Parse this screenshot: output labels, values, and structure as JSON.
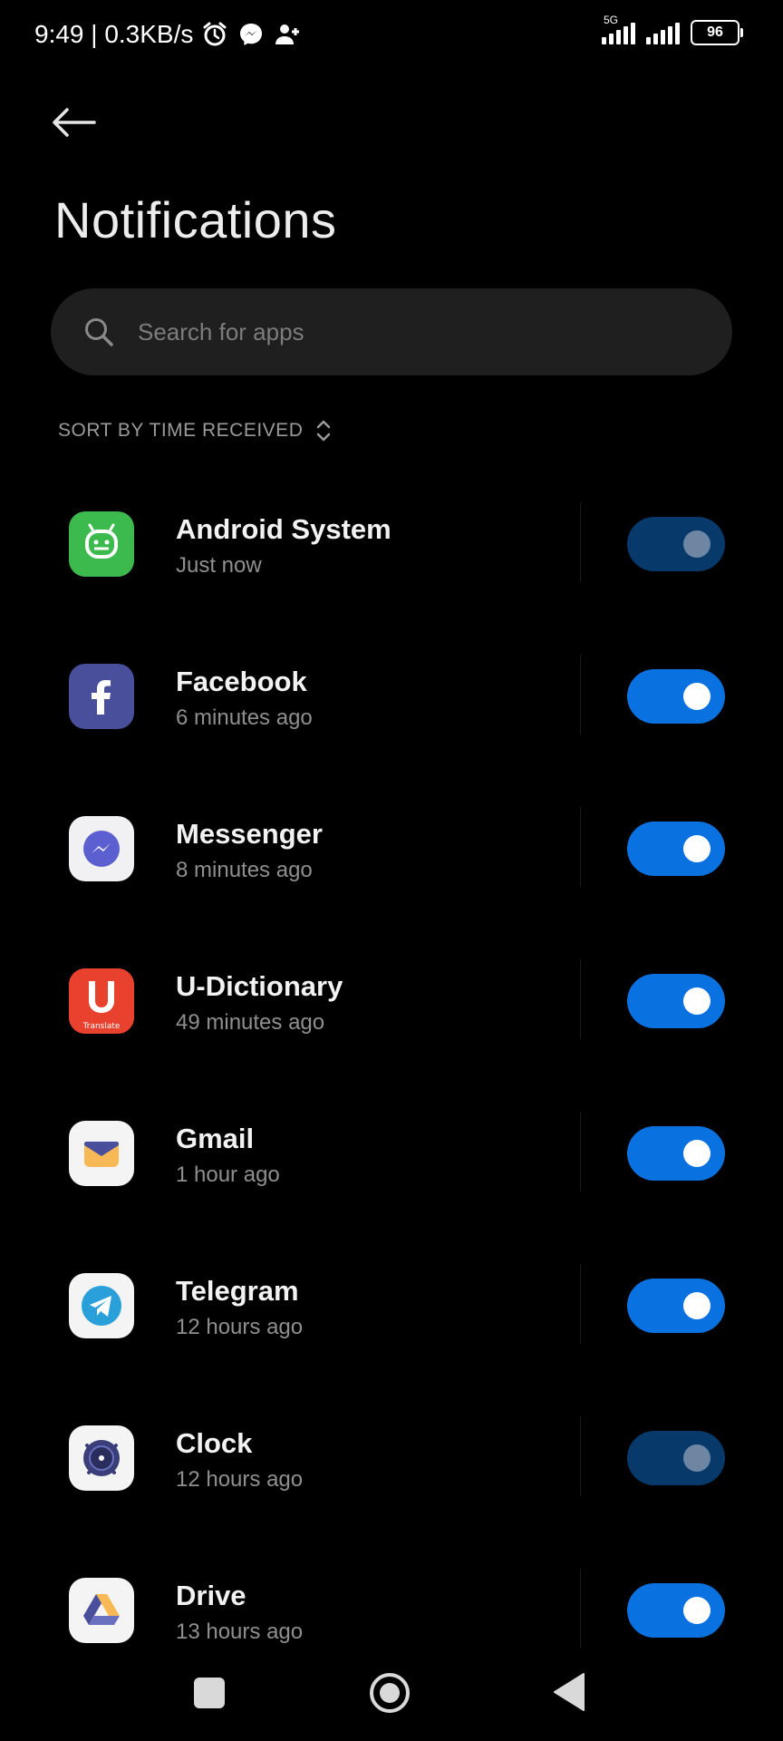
{
  "status_bar": {
    "time_speed": "9:49 | 0.3KB/s",
    "network_tag": "5G",
    "battery": "96",
    "icons": [
      "alarm-icon",
      "messenger-icon",
      "add-user-icon",
      "signal-icon",
      "battery-icon"
    ]
  },
  "header": {
    "title": "Notifications",
    "back_icon": "back-arrow-icon"
  },
  "search": {
    "placeholder": "Search for apps",
    "value": ""
  },
  "sort": {
    "label": "SORT BY TIME RECEIVED",
    "icon": "sort-updown-icon"
  },
  "apps": [
    {
      "name": "Android System",
      "time": "Just now",
      "enabled": true,
      "dimmed": true,
      "icon": "android-system-icon"
    },
    {
      "name": "Facebook",
      "time": "6 minutes ago",
      "enabled": true,
      "dimmed": false,
      "icon": "facebook-icon"
    },
    {
      "name": "Messenger",
      "time": "8 minutes ago",
      "enabled": true,
      "dimmed": false,
      "icon": "messenger-icon"
    },
    {
      "name": "U-Dictionary",
      "time": "49 minutes ago",
      "enabled": true,
      "dimmed": false,
      "icon": "u-dictionary-icon",
      "icon_caption": "Translate"
    },
    {
      "name": "Gmail",
      "time": "1 hour ago",
      "enabled": true,
      "dimmed": false,
      "icon": "gmail-icon"
    },
    {
      "name": "Telegram",
      "time": "12 hours ago",
      "enabled": true,
      "dimmed": false,
      "icon": "telegram-icon"
    },
    {
      "name": "Clock",
      "time": "12 hours ago",
      "enabled": true,
      "dimmed": true,
      "icon": "clock-icon"
    },
    {
      "name": "Drive",
      "time": "13 hours ago",
      "enabled": true,
      "dimmed": false,
      "icon": "drive-icon"
    }
  ],
  "colors": {
    "background": "#000000",
    "toggle_on": "#0a72e0",
    "toggle_dim": "#073a6b",
    "search_bg": "#1f1f1f"
  },
  "nav": {
    "icons": [
      "recents-icon",
      "home-icon",
      "back-icon"
    ]
  }
}
